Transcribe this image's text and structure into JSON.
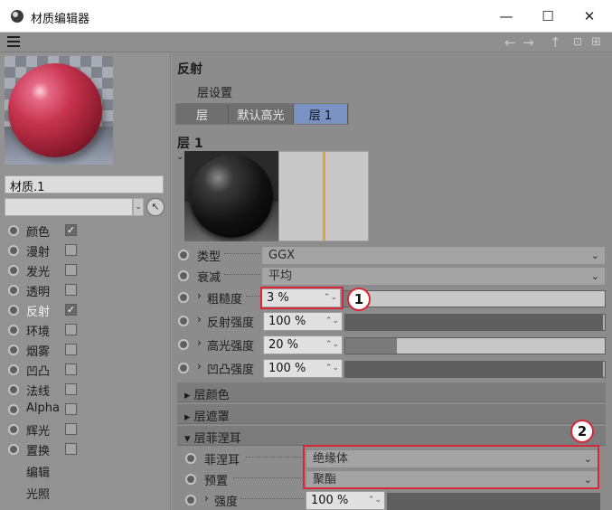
{
  "window": {
    "title": "材质编辑器",
    "minimize": "—",
    "maximize": "☐",
    "close": "✕"
  },
  "toolbar": {
    "menu_icon": "hamburger-menu-icon",
    "back": "←",
    "forward": "→",
    "up": "↑",
    "lock": "🔒",
    "new_window": "⊞"
  },
  "sidebar": {
    "material_name": "材质.1",
    "channels": [
      {
        "label": "颜色",
        "checked": true,
        "active": false
      },
      {
        "label": "漫射",
        "checked": false,
        "active": false
      },
      {
        "label": "发光",
        "checked": false,
        "active": false
      },
      {
        "label": "透明",
        "checked": false,
        "active": false
      },
      {
        "label": "反射",
        "checked": true,
        "active": true
      },
      {
        "label": "环境",
        "checked": false,
        "active": false
      },
      {
        "label": "烟雾",
        "checked": false,
        "active": false
      },
      {
        "label": "凹凸",
        "checked": false,
        "active": false
      },
      {
        "label": "法线",
        "checked": false,
        "active": false
      },
      {
        "label": "Alpha",
        "checked": false,
        "active": false
      },
      {
        "label": "辉光",
        "checked": false,
        "active": false
      },
      {
        "label": "置换",
        "checked": false,
        "active": false
      }
    ],
    "edit_label": "编辑",
    "lighting_label": "光照"
  },
  "main": {
    "section_title": "反射",
    "layer_settings": "层设置",
    "tabs": [
      "层",
      "默认高光",
      "层 1"
    ],
    "active_tab": 2,
    "layer_title": "层 1",
    "params": {
      "type_label": "类型",
      "type_value": "GGX",
      "atten_label": "衰减",
      "atten_value": "平均",
      "rough_label": "粗糙度",
      "rough_value": "3 %",
      "rough_level": 0.03,
      "refl_label": "反射强度",
      "refl_value": "100 %",
      "refl_level": 1.0,
      "spec_label": "高光强度",
      "spec_value": "20 %",
      "spec_level": 0.2,
      "bump_label": "凹凸强度",
      "bump_value": "100 %",
      "bump_level": 1.0
    },
    "groups": {
      "layer_color": "层颜色",
      "layer_mask": "层遮罩",
      "layer_fresnel": "层菲涅耳"
    },
    "fresnel": {
      "fresnel_label": "菲涅耳",
      "fresnel_value": "绝缘体",
      "preset_label": "预置",
      "preset_value": "聚酯",
      "strength_label": "强度",
      "strength_value": "100 %",
      "strength_level": 1.0
    }
  },
  "callouts": {
    "one": "1",
    "two": "2",
    "accent": "#d7283a"
  }
}
